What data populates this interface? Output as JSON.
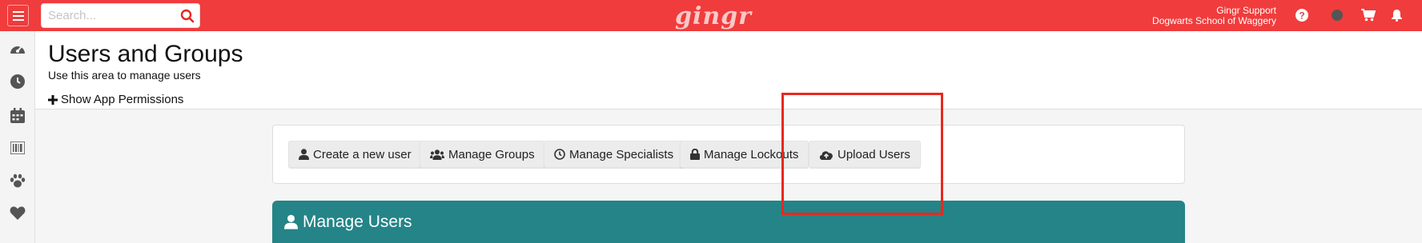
{
  "topbar": {
    "search_placeholder": "Search...",
    "logo": "gingr",
    "account_name": "Gingr Support",
    "account_org": "Dogwarts School of Waggery",
    "bg_color": "#f03c3c"
  },
  "sidebar": {
    "icons": [
      "dashboard-icon",
      "clock-icon",
      "calendar-icon",
      "barcode-icon",
      "paw-icon",
      "heart-icon"
    ]
  },
  "header": {
    "title": "Users and Groups",
    "subtitle": "Use this area to manage users",
    "show_permissions": "Show App Permissions"
  },
  "actions": {
    "create_user": "Create a new user",
    "manage_groups": "Manage Groups",
    "manage_specialists": "Manage Specialists",
    "manage_lockouts": "Manage Lockouts",
    "upload_users": "Upload Users"
  },
  "card": {
    "title": "Manage Users",
    "color": "#248487"
  },
  "highlight_color": "#e8281e"
}
